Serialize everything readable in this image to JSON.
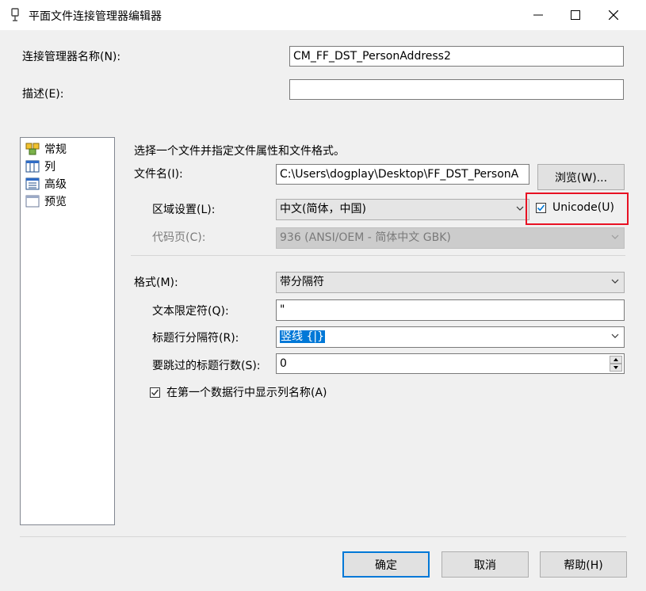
{
  "window": {
    "title": "平面文件连接管理器编辑器"
  },
  "form": {
    "name_label": "连接管理器名称(N):",
    "name_value": "CM_FF_DST_PersonAddress2",
    "desc_label": "描述(E):",
    "desc_value": ""
  },
  "nav": {
    "items": [
      {
        "label": "常规",
        "icon": "general-icon"
      },
      {
        "label": "列",
        "icon": "columns-icon"
      },
      {
        "label": "高级",
        "icon": "advanced-icon"
      },
      {
        "label": "预览",
        "icon": "preview-icon"
      }
    ]
  },
  "general": {
    "instruction": "选择一个文件并指定文件属性和文件格式。",
    "filename_label": "文件名(I):",
    "filename_value": "C:\\Users\\dogplay\\Desktop\\FF_DST_PersonA",
    "browse_label": "浏览(W)...",
    "locale_label": "区域设置(L):",
    "locale_value": "中文(简体，中国)",
    "unicode_label": "Unicode(U)",
    "unicode_checked": true,
    "codepage_label": "代码页(C):",
    "codepage_value": "936  (ANSI/OEM - 简体中文 GBK)",
    "format_label": "格式(M):",
    "format_value": "带分隔符",
    "qualifier_label": "文本限定符(Q):",
    "qualifier_value": "\"",
    "header_delim_label": "标题行分隔符(R):",
    "header_delim_value": "竖线 {|}",
    "skip_rows_label": "要跳过的标题行数(S):",
    "skip_rows_value": "0",
    "first_row_label": "在第一个数据行中显示列名称(A)",
    "first_row_checked": true
  },
  "buttons": {
    "ok": "确定",
    "cancel": "取消",
    "help": "帮助(H)"
  },
  "colors": {
    "highlight_box": "#e81123",
    "accent": "#0078d7"
  }
}
